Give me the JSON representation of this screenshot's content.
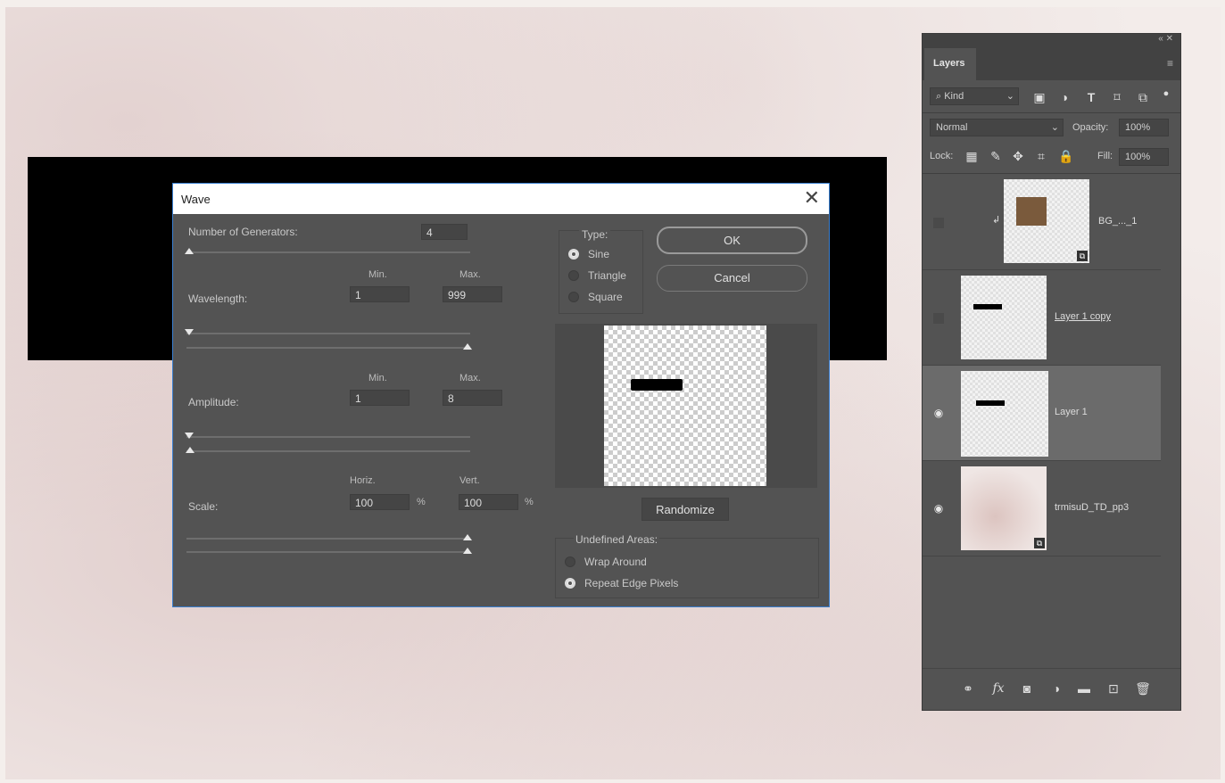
{
  "wave_dialog": {
    "title": "Wave",
    "close": "✕",
    "generators_label": "Number of Generators:",
    "generators_value": "4",
    "wavelength": {
      "label": "Wavelength:",
      "min_label": "Min.",
      "max_label": "Max.",
      "min": "1",
      "max": "999"
    },
    "amplitude": {
      "label": "Amplitude:",
      "min_label": "Min.",
      "max_label": "Max.",
      "min": "1",
      "max": "8"
    },
    "scale": {
      "label": "Scale:",
      "horiz_label": "Horiz.",
      "vert_label": "Vert.",
      "horiz": "100",
      "vert": "100",
      "unit": "%"
    },
    "type": {
      "label": "Type:",
      "options": [
        "Sine",
        "Triangle",
        "Square"
      ],
      "selected": "Sine"
    },
    "ok_label": "OK",
    "cancel_label": "Cancel",
    "randomize_label": "Randomize",
    "undefined_areas": {
      "label": "Undefined Areas:",
      "options": [
        "Wrap Around",
        "Repeat Edge Pixels"
      ],
      "selected": "Repeat Edge Pixels"
    }
  },
  "layers_panel": {
    "tab": "Layers",
    "filter": "Kind",
    "blend_mode": "Normal",
    "opacity_label": "Opacity:",
    "opacity": "100%",
    "lock_label": "Lock:",
    "fill_label": "Fill:",
    "fill": "100%",
    "layers": [
      {
        "name": "BG_..._1",
        "visible": false
      },
      {
        "name": "Layer 1 copy",
        "visible": false
      },
      {
        "name": "Layer 1",
        "visible": true,
        "selected": true
      },
      {
        "name": "trmisuD_TD_pp3",
        "visible": true
      }
    ]
  }
}
